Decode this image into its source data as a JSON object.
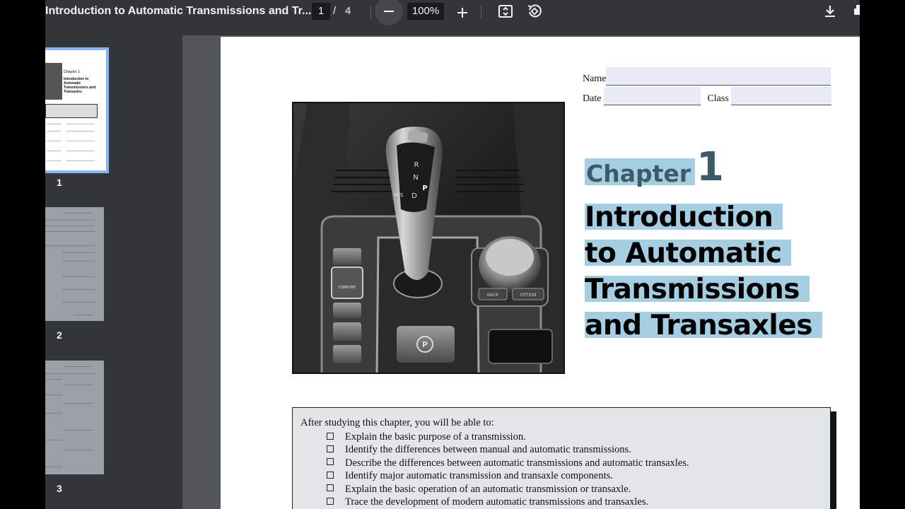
{
  "toolbar": {
    "title": "Introduction to Automatic Transmissions and Tr...",
    "current_page": "1",
    "separator": "/",
    "total_pages": "4",
    "zoom": "100%",
    "icons": [
      "zoom-out-icon",
      "zoom-in-icon",
      "fit-page-icon",
      "rotate-icon",
      "download-icon",
      "print-icon"
    ]
  },
  "sidebar": {
    "thumbnails": [
      {
        "number": "1",
        "selected": true,
        "mini_chapter": "Chapter",
        "mini_chapter_num": "1",
        "mini_title": "Introduction to Automatic Transmissions and Transaxles"
      },
      {
        "number": "2",
        "selected": false
      },
      {
        "number": "3",
        "selected": false
      }
    ]
  },
  "document": {
    "name_label": "Name",
    "date_label": "Date",
    "class_label": "Class",
    "chapter_label": "Chapter",
    "chapter_number": "1",
    "title_lines": [
      "Introduction",
      "to Automatic",
      "Transmissions",
      "and Transaxles"
    ],
    "photo": {
      "shifter_letters": [
        "R",
        "N",
        "D"
      ],
      "shifter_side": "M/S",
      "park_button": "P",
      "back_label": "BACK",
      "option_label": "OPTION",
      "comfort_label": "COMFORT"
    },
    "objectives": {
      "intro": "After studying this chapter, you will be able to:",
      "items": [
        "Explain the basic purpose of a transmission.",
        "Identify the differences between manual and automatic transmissions.",
        "Describe the differences between automatic transmissions and automatic transaxles.",
        "Identify major automatic transmission and transaxle components.",
        "Explain the basic operation of an automatic transmission or transaxle.",
        "Trace the development of modern automatic transmissions and transaxles."
      ]
    }
  },
  "colors": {
    "toolbar_bg": "#323639",
    "viewer_bg": "#525659",
    "highlight": "#a6cee3",
    "thumbnail_selected": "#8ab4f8",
    "form_field": "#e8eaf6"
  }
}
